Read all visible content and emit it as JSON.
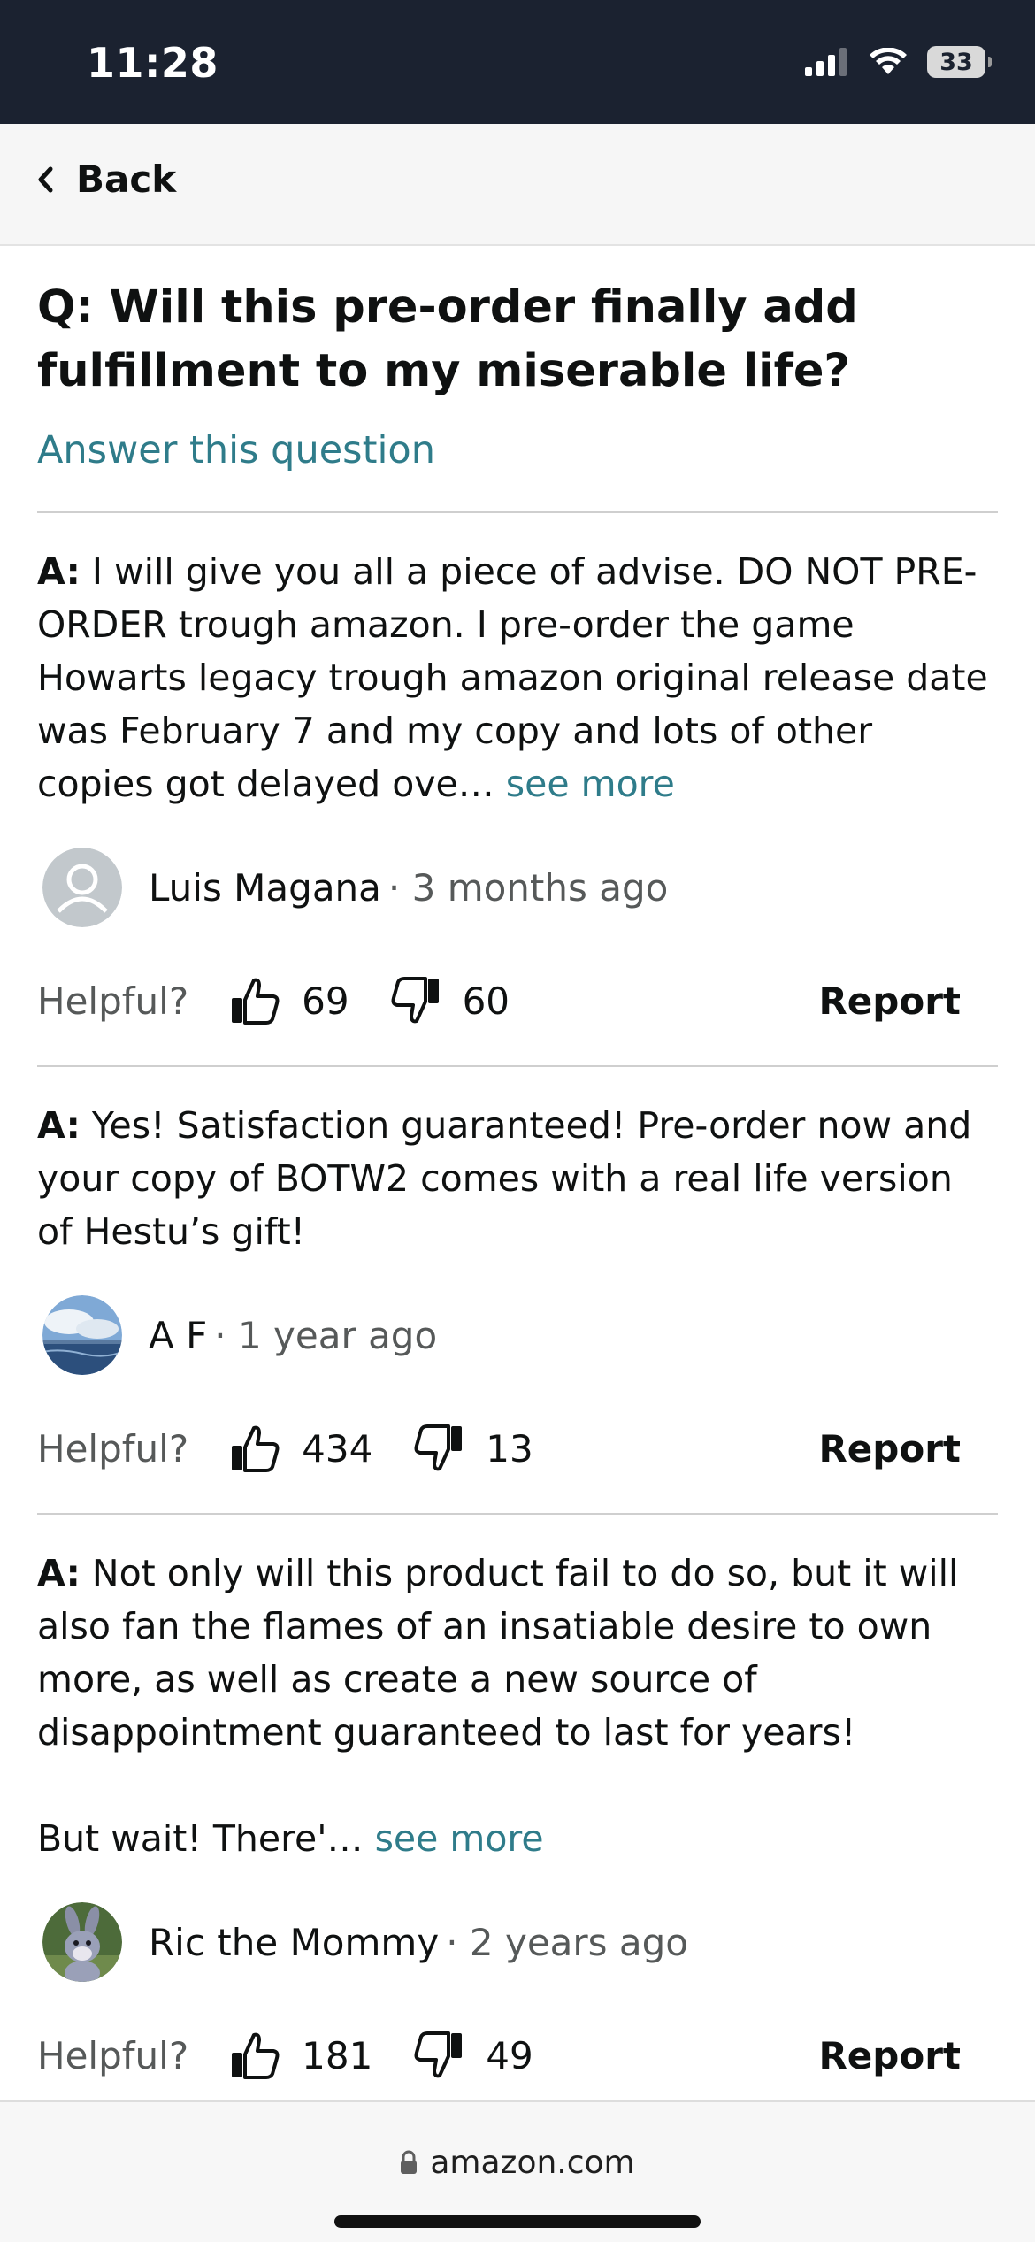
{
  "status_bar": {
    "time": "11:28",
    "battery": "33"
  },
  "nav": {
    "back_label": "Back"
  },
  "question": {
    "text": "Q: Will this pre-order finally add fulfillment to my miserable life?",
    "answer_link": "Answer this question"
  },
  "answers": [
    {
      "prefix": "A:",
      "text": " I will give you all a piece of advise. DO NOT PRE-ORDER trough amazon. I pre-order the game Howarts legacy trough amazon original release date was February 7 and my copy and lots of other copies got delayed ove… ",
      "see_more": "see more",
      "author": "Luis Magana",
      "time": "· 3 months ago",
      "helpful_label": "Helpful?",
      "up": "69",
      "down": "60",
      "report": "Report",
      "avatar_icon": "default-user-avatar-icon"
    },
    {
      "prefix": "A:",
      "text": " Yes! Satisfaction guaranteed! Pre-order now and your copy of BOTW2 comes with a real life version of Hestu’s gift!",
      "see_more": "",
      "author": "A F",
      "time": "· 1 year ago",
      "helpful_label": "Helpful?",
      "up": "434",
      "down": "13",
      "report": "Report",
      "avatar_icon": "sky-ocean-avatar"
    },
    {
      "prefix": "A:",
      "text": " Not only will this product fail to do so, but it will also fan the flames of an insatiable desire to own more, as well as create a new source of disappointment guaranteed to last for years!\n\nBut wait! There'… ",
      "see_more": "see more",
      "author": "Ric the Mommy",
      "time": "· 2 years ago",
      "helpful_label": "Helpful?",
      "up": "181",
      "down": "49",
      "report": "Report",
      "avatar_icon": "rabbit-avatar"
    }
  ],
  "browser": {
    "url": "amazon.com"
  },
  "colors": {
    "link": "#2f7c8a",
    "status_bar": "#1b2230",
    "text": "#0f1111",
    "muted": "#565959"
  }
}
